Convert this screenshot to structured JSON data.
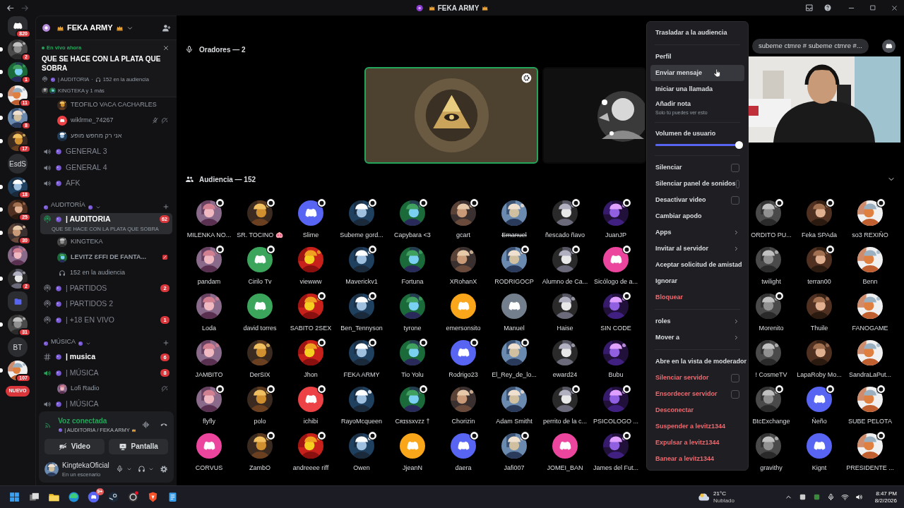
{
  "title_bar": {
    "title": "FEKA ARMY"
  },
  "servers": [
    {
      "kind": "home",
      "badge": "820",
      "unread": false
    },
    {
      "kind": "picture",
      "badge": "2",
      "unread": true
    },
    {
      "kind": "picture",
      "badge": "1",
      "unread": true
    },
    {
      "kind": "picture",
      "badge": "11",
      "unread": true
    },
    {
      "kind": "picture",
      "badge": "8",
      "unread": true
    },
    {
      "kind": "picture",
      "badge": "17",
      "unread": true
    },
    {
      "kind": "text",
      "label": "EsdS",
      "unread": false
    },
    {
      "kind": "picture",
      "badge": "18",
      "unread": true
    },
    {
      "kind": "picture",
      "badge": "25",
      "unread": true
    },
    {
      "kind": "picture",
      "badge": "30",
      "unread": true
    },
    {
      "kind": "picture",
      "unread": false
    },
    {
      "kind": "picture",
      "badge": "2",
      "unread": true
    },
    {
      "kind": "folder",
      "unread": false
    },
    {
      "kind": "picture",
      "badge": "31",
      "unread": true
    },
    {
      "kind": "text",
      "label": "BT",
      "unread": false
    },
    {
      "kind": "picture",
      "badge": "107",
      "unread": true
    }
  ],
  "new_badge": "NUEVO",
  "server_header": {
    "name": "FEKA ARMY"
  },
  "live_banner": {
    "status": "En vivo ahora",
    "title": "QUE SE HACE CON LA PLATA QUE SOBRA",
    "channel": "| AUDITORIA",
    "separator": "·",
    "audience": "152 en la audiencia",
    "speakers": "KINGTEKA y 1 más"
  },
  "channel_list": [
    {
      "kind": "member",
      "name": "TEOFILO VACA CACHARLES",
      "muted": false,
      "deafened": false,
      "live": false
    },
    {
      "kind": "member",
      "name": "wiklrme_74267",
      "color": "#ed4245",
      "muted": true,
      "deafened": true,
      "live": false
    },
    {
      "kind": "member",
      "name": "אני רק מחפש מופע",
      "muted": false,
      "deafened": false,
      "live": false
    },
    {
      "kind": "voice",
      "name": "GENERAL 3",
      "active": false
    },
    {
      "kind": "voice",
      "name": "GENERAL 4",
      "active": false
    },
    {
      "kind": "voice",
      "name": "AFK",
      "active": false
    },
    {
      "kind": "category",
      "name": "AUDITORÍA"
    },
    {
      "kind": "stage",
      "name": "| AUDITORIA",
      "selected": true,
      "badge": "62",
      "subtitle": "QUE SE HACE CON LA PLATA QUE SOBRA"
    },
    {
      "kind": "member",
      "name": "KINGTEKA",
      "muted": false,
      "deafened": false,
      "live": false
    },
    {
      "kind": "member",
      "name": "LEVITZ ƐFFI DE FANTA...",
      "muted": false,
      "deafened": false,
      "live": true
    },
    {
      "kind": "audience_count",
      "name": "152 en la audiencia"
    },
    {
      "kind": "stage",
      "name": "| PARTIDOS",
      "selected": false,
      "badge": "2"
    },
    {
      "kind": "stage",
      "name": "| PARTIDOS 2",
      "selected": false
    },
    {
      "kind": "stage",
      "name": "| +18 EN VIVO",
      "selected": false,
      "badge": "1"
    },
    {
      "kind": "category",
      "name": "MÚSICA"
    },
    {
      "kind": "text",
      "name": "| musica",
      "unread": true,
      "badge": "6"
    },
    {
      "kind": "voice",
      "name": "| MÚSICA",
      "active": true,
      "badge": "8"
    },
    {
      "kind": "member",
      "name": "Lofi Radio",
      "muted": false,
      "deafened": true,
      "live": false
    },
    {
      "kind": "voice",
      "name": "| MÚSICA",
      "active": false
    }
  ],
  "voice_panel": {
    "status": "Voz conectada",
    "location": "| AUDITORIA / FEKA ARMY",
    "buttons": [
      "Video",
      "Pantalla"
    ]
  },
  "user_panel": {
    "name": "KingtekaOficial",
    "status": "En un escenario"
  },
  "speakers": {
    "header": "Oradores — 2",
    "tiles": [
      {
        "speaking": true
      },
      {
        "speaking": false
      }
    ]
  },
  "chat_pill": "subeme ctmre # subeme ctmre #...",
  "audience": {
    "header": "Audiencia — 152",
    "members": [
      {
        "name": "MILENKA NO...",
        "badge": true,
        "struck": false
      },
      {
        "name": "SR. TOCINO 🐽",
        "badge": true,
        "struck": false
      },
      {
        "name": "Slime",
        "color": "#5865f2",
        "badge": true,
        "struck": false
      },
      {
        "name": "Subeme gord...",
        "badge": true,
        "struck": false
      },
      {
        "name": "Capybara <3",
        "badge": true,
        "struck": false
      },
      {
        "name": "gcart",
        "badge": true,
        "struck": false
      },
      {
        "name": "Emanuel",
        "badge": false,
        "struck": true
      },
      {
        "name": "ñescado ñavo",
        "badge": true,
        "struck": false
      },
      {
        "name": "JuanJP",
        "badge": true,
        "struck": false
      },
      {
        "name": "ORDITO PU...",
        "badge": true,
        "struck": false
      },
      {
        "name": "Feka SPAda",
        "badge": true,
        "struck": false
      },
      {
        "name": "so3 REXIÑO",
        "badge": true,
        "struck": false
      },
      {
        "name": "pandam",
        "badge": true,
        "struck": false
      },
      {
        "name": "Cirilo Tv",
        "color": "#3ba55c",
        "badge": true,
        "struck": false
      },
      {
        "name": "viewww",
        "badge": false,
        "struck": false
      },
      {
        "name": "Maverickv1",
        "badge": true,
        "struck": false
      },
      {
        "name": "Fortuna",
        "badge": false,
        "struck": false
      },
      {
        "name": "XRohanX",
        "badge": false,
        "struck": false
      },
      {
        "name": "RODRIGOCP",
        "badge": true,
        "struck": false
      },
      {
        "name": "Alumno de Ca...",
        "badge": true,
        "struck": false
      },
      {
        "name": "Sicólogo de a...",
        "color": "#eb459e",
        "badge": true,
        "struck": false
      },
      {
        "name": "twilight",
        "badge": false,
        "struck": false
      },
      {
        "name": "terran00",
        "badge": true,
        "struck": false
      },
      {
        "name": "Benn",
        "badge": false,
        "struck": false
      },
      {
        "name": "Loda",
        "badge": false,
        "struck": false
      },
      {
        "name": "david torres",
        "color": "#3ba55c",
        "badge": false,
        "struck": false
      },
      {
        "name": "SABITO 2SEX",
        "badge": true,
        "struck": false
      },
      {
        "name": "Ben_Tennyson",
        "badge": true,
        "struck": false
      },
      {
        "name": "tyrone",
        "badge": false,
        "struck": false
      },
      {
        "name": "emersonsito",
        "color": "#faa61a",
        "badge": false,
        "struck": false
      },
      {
        "name": "Manuel",
        "color": "#747f8d",
        "badge": false,
        "struck": false
      },
      {
        "name": "Haise",
        "badge": false,
        "struck": false
      },
      {
        "name": "SIN CODE",
        "badge": true,
        "struck": false
      },
      {
        "name": "Morenito",
        "badge": true,
        "struck": false
      },
      {
        "name": "Thuile",
        "badge": false,
        "struck": false
      },
      {
        "name": "FANOGAME",
        "badge": false,
        "struck": false
      },
      {
        "name": "JAMBITO",
        "badge": false,
        "struck": false
      },
      {
        "name": "DerSIX",
        "badge": false,
        "struck": false
      },
      {
        "name": "Jhon",
        "badge": true,
        "struck": false
      },
      {
        "name": "FEKA ARMY",
        "badge": true,
        "struck": false
      },
      {
        "name": "Tio Yolu",
        "badge": true,
        "struck": false
      },
      {
        "name": "Rodrigo23",
        "color": "#5865f2",
        "badge": true,
        "struck": false
      },
      {
        "name": "El_Rey_de_lo...",
        "badge": true,
        "struck": false
      },
      {
        "name": "eward24",
        "badge": false,
        "struck": false
      },
      {
        "name": "Bubu",
        "badge": false,
        "struck": false
      },
      {
        "name": "! CosmeTV",
        "badge": false,
        "struck": false
      },
      {
        "name": "LapaRoby Mo...",
        "badge": false,
        "struck": false
      },
      {
        "name": "SandraLaPut...",
        "badge": false,
        "struck": false
      },
      {
        "name": "flyfly",
        "badge": true,
        "struck": false
      },
      {
        "name": "polo",
        "badge": true,
        "struck": false
      },
      {
        "name": "ichibi",
        "color": "#ed4245",
        "badge": true,
        "struck": false
      },
      {
        "name": "RayoMcqueen",
        "badge": false,
        "struck": false
      },
      {
        "name": "Cʀɪssxvzz †",
        "badge": true,
        "struck": false
      },
      {
        "name": "Chorizin",
        "badge": false,
        "struck": false
      },
      {
        "name": "Adam Smitht",
        "badge": false,
        "struck": false
      },
      {
        "name": "perrito de la c...",
        "badge": true,
        "struck": false
      },
      {
        "name": "PSICOLOGO ...",
        "badge": true,
        "struck": false
      },
      {
        "name": "BtcExchange",
        "badge": true,
        "struck": false
      },
      {
        "name": "Ñeño",
        "color": "#5865f2",
        "badge": true,
        "struck": false
      },
      {
        "name": "SUBE PELOTA",
        "badge": true,
        "struck": false
      },
      {
        "name": "CORVUS",
        "color": "#eb459e",
        "badge": false,
        "struck": false
      },
      {
        "name": "ZambO",
        "badge": true,
        "struck": false
      },
      {
        "name": "andreeee riff",
        "badge": true,
        "struck": false
      },
      {
        "name": "Owen",
        "badge": true,
        "struck": false
      },
      {
        "name": "JjeanN",
        "color": "#faa61a",
        "badge": false,
        "struck": false
      },
      {
        "name": "daera",
        "color": "#5865f2",
        "badge": true,
        "struck": false
      },
      {
        "name": "Jafi007",
        "badge": true,
        "struck": false
      },
      {
        "name": "JOMEI_BAN",
        "color": "#eb459e",
        "badge": false,
        "struck": false
      },
      {
        "name": "James del Fut...",
        "badge": true,
        "struck": false
      },
      {
        "name": "gravithy",
        "badge": false,
        "struck": false
      },
      {
        "name": "Kignt",
        "color": "#5865f2",
        "badge": false,
        "struck": false
      },
      {
        "name": "PRESIDENTE ...",
        "badge": true,
        "struck": false
      }
    ]
  },
  "menu": {
    "groups": [
      [
        {
          "label": "Trasladar a la audiencia",
          "kind": "action",
          "danger": false,
          "highlighted": false
        }
      ],
      [
        {
          "label": "Perfil",
          "kind": "action",
          "danger": false,
          "highlighted": false
        },
        {
          "label": "Enviar mensaje",
          "kind": "action",
          "danger": false,
          "highlighted": true
        },
        {
          "label": "Iniciar una llamada",
          "kind": "action",
          "danger": false,
          "highlighted": false
        },
        {
          "label": "Añadir nota",
          "kind": "note",
          "caption": "Solo tú puedes ver esto",
          "danger": false,
          "highlighted": false
        }
      ],
      [
        {
          "label": "Volumen de usuario",
          "kind": "slider",
          "level": 1
        }
      ],
      [
        {
          "label": "Silenciar",
          "kind": "checkbox",
          "checked": false,
          "danger": false,
          "highlighted": false
        },
        {
          "label": "Silenciar panel de sonidos",
          "kind": "checkbox",
          "checked": false,
          "danger": false,
          "highlighted": false
        },
        {
          "label": "Desactivar video",
          "kind": "checkbox",
          "checked": false,
          "danger": false,
          "highlighted": false
        },
        {
          "label": "Cambiar apodo",
          "kind": "action",
          "danger": false,
          "highlighted": false
        },
        {
          "label": "Apps",
          "kind": "submenu",
          "danger": false,
          "highlighted": false
        },
        {
          "label": "Invitar al servidor",
          "kind": "submenu",
          "danger": false,
          "highlighted": false
        },
        {
          "label": "Aceptar solicitud de amistad",
          "kind": "action",
          "danger": false,
          "highlighted": false
        },
        {
          "label": "Ignorar",
          "kind": "action",
          "danger": false,
          "highlighted": false
        },
        {
          "label": "Bloquear",
          "kind": "action",
          "danger": true,
          "highlighted": false
        }
      ],
      [
        {
          "label": "roles",
          "kind": "submenu",
          "danger": false,
          "highlighted": false
        },
        {
          "label": "Mover a",
          "kind": "submenu",
          "danger": false,
          "highlighted": false
        }
      ],
      [
        {
          "label": "Abre en la vista de moderador",
          "kind": "action",
          "danger": false,
          "highlighted": false
        },
        {
          "label": "Silenciar servidor",
          "kind": "checkbox",
          "checked": false,
          "danger": true,
          "highlighted": false
        },
        {
          "label": "Ensordecer servidor",
          "kind": "checkbox",
          "checked": false,
          "danger": true,
          "highlighted": false
        },
        {
          "label": "Desconectar",
          "kind": "action",
          "danger": true,
          "highlighted": false
        },
        {
          "label": "Suspender a levitz1344",
          "kind": "action",
          "danger": true,
          "highlighted": false
        },
        {
          "label": "Expulsar a levitz1344",
          "kind": "action",
          "danger": true,
          "highlighted": false
        },
        {
          "label": "Banear a levitz1344",
          "kind": "action",
          "danger": true,
          "highlighted": false
        }
      ]
    ]
  },
  "taskbar": {
    "discord_badge": "9+",
    "temperature": "21°C",
    "weather": "Nublado",
    "time": "8:47 PM",
    "date": "8/2/2026"
  }
}
